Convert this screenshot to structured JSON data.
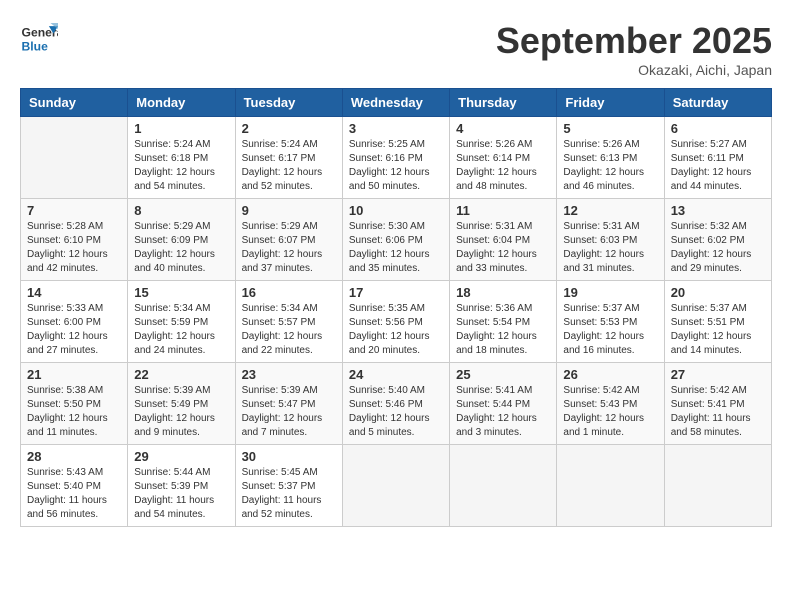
{
  "header": {
    "logo_line1": "General",
    "logo_line2": "Blue",
    "month": "September 2025",
    "location": "Okazaki, Aichi, Japan"
  },
  "weekdays": [
    "Sunday",
    "Monday",
    "Tuesday",
    "Wednesday",
    "Thursday",
    "Friday",
    "Saturday"
  ],
  "weeks": [
    [
      {
        "day": "",
        "info": ""
      },
      {
        "day": "1",
        "info": "Sunrise: 5:24 AM\nSunset: 6:18 PM\nDaylight: 12 hours\nand 54 minutes."
      },
      {
        "day": "2",
        "info": "Sunrise: 5:24 AM\nSunset: 6:17 PM\nDaylight: 12 hours\nand 52 minutes."
      },
      {
        "day": "3",
        "info": "Sunrise: 5:25 AM\nSunset: 6:16 PM\nDaylight: 12 hours\nand 50 minutes."
      },
      {
        "day": "4",
        "info": "Sunrise: 5:26 AM\nSunset: 6:14 PM\nDaylight: 12 hours\nand 48 minutes."
      },
      {
        "day": "5",
        "info": "Sunrise: 5:26 AM\nSunset: 6:13 PM\nDaylight: 12 hours\nand 46 minutes."
      },
      {
        "day": "6",
        "info": "Sunrise: 5:27 AM\nSunset: 6:11 PM\nDaylight: 12 hours\nand 44 minutes."
      }
    ],
    [
      {
        "day": "7",
        "info": "Sunrise: 5:28 AM\nSunset: 6:10 PM\nDaylight: 12 hours\nand 42 minutes."
      },
      {
        "day": "8",
        "info": "Sunrise: 5:29 AM\nSunset: 6:09 PM\nDaylight: 12 hours\nand 40 minutes."
      },
      {
        "day": "9",
        "info": "Sunrise: 5:29 AM\nSunset: 6:07 PM\nDaylight: 12 hours\nand 37 minutes."
      },
      {
        "day": "10",
        "info": "Sunrise: 5:30 AM\nSunset: 6:06 PM\nDaylight: 12 hours\nand 35 minutes."
      },
      {
        "day": "11",
        "info": "Sunrise: 5:31 AM\nSunset: 6:04 PM\nDaylight: 12 hours\nand 33 minutes."
      },
      {
        "day": "12",
        "info": "Sunrise: 5:31 AM\nSunset: 6:03 PM\nDaylight: 12 hours\nand 31 minutes."
      },
      {
        "day": "13",
        "info": "Sunrise: 5:32 AM\nSunset: 6:02 PM\nDaylight: 12 hours\nand 29 minutes."
      }
    ],
    [
      {
        "day": "14",
        "info": "Sunrise: 5:33 AM\nSunset: 6:00 PM\nDaylight: 12 hours\nand 27 minutes."
      },
      {
        "day": "15",
        "info": "Sunrise: 5:34 AM\nSunset: 5:59 PM\nDaylight: 12 hours\nand 24 minutes."
      },
      {
        "day": "16",
        "info": "Sunrise: 5:34 AM\nSunset: 5:57 PM\nDaylight: 12 hours\nand 22 minutes."
      },
      {
        "day": "17",
        "info": "Sunrise: 5:35 AM\nSunset: 5:56 PM\nDaylight: 12 hours\nand 20 minutes."
      },
      {
        "day": "18",
        "info": "Sunrise: 5:36 AM\nSunset: 5:54 PM\nDaylight: 12 hours\nand 18 minutes."
      },
      {
        "day": "19",
        "info": "Sunrise: 5:37 AM\nSunset: 5:53 PM\nDaylight: 12 hours\nand 16 minutes."
      },
      {
        "day": "20",
        "info": "Sunrise: 5:37 AM\nSunset: 5:51 PM\nDaylight: 12 hours\nand 14 minutes."
      }
    ],
    [
      {
        "day": "21",
        "info": "Sunrise: 5:38 AM\nSunset: 5:50 PM\nDaylight: 12 hours\nand 11 minutes."
      },
      {
        "day": "22",
        "info": "Sunrise: 5:39 AM\nSunset: 5:49 PM\nDaylight: 12 hours\nand 9 minutes."
      },
      {
        "day": "23",
        "info": "Sunrise: 5:39 AM\nSunset: 5:47 PM\nDaylight: 12 hours\nand 7 minutes."
      },
      {
        "day": "24",
        "info": "Sunrise: 5:40 AM\nSunset: 5:46 PM\nDaylight: 12 hours\nand 5 minutes."
      },
      {
        "day": "25",
        "info": "Sunrise: 5:41 AM\nSunset: 5:44 PM\nDaylight: 12 hours\nand 3 minutes."
      },
      {
        "day": "26",
        "info": "Sunrise: 5:42 AM\nSunset: 5:43 PM\nDaylight: 12 hours\nand 1 minute."
      },
      {
        "day": "27",
        "info": "Sunrise: 5:42 AM\nSunset: 5:41 PM\nDaylight: 11 hours\nand 58 minutes."
      }
    ],
    [
      {
        "day": "28",
        "info": "Sunrise: 5:43 AM\nSunset: 5:40 PM\nDaylight: 11 hours\nand 56 minutes."
      },
      {
        "day": "29",
        "info": "Sunrise: 5:44 AM\nSunset: 5:39 PM\nDaylight: 11 hours\nand 54 minutes."
      },
      {
        "day": "30",
        "info": "Sunrise: 5:45 AM\nSunset: 5:37 PM\nDaylight: 11 hours\nand 52 minutes."
      },
      {
        "day": "",
        "info": ""
      },
      {
        "day": "",
        "info": ""
      },
      {
        "day": "",
        "info": ""
      },
      {
        "day": "",
        "info": ""
      }
    ]
  ]
}
